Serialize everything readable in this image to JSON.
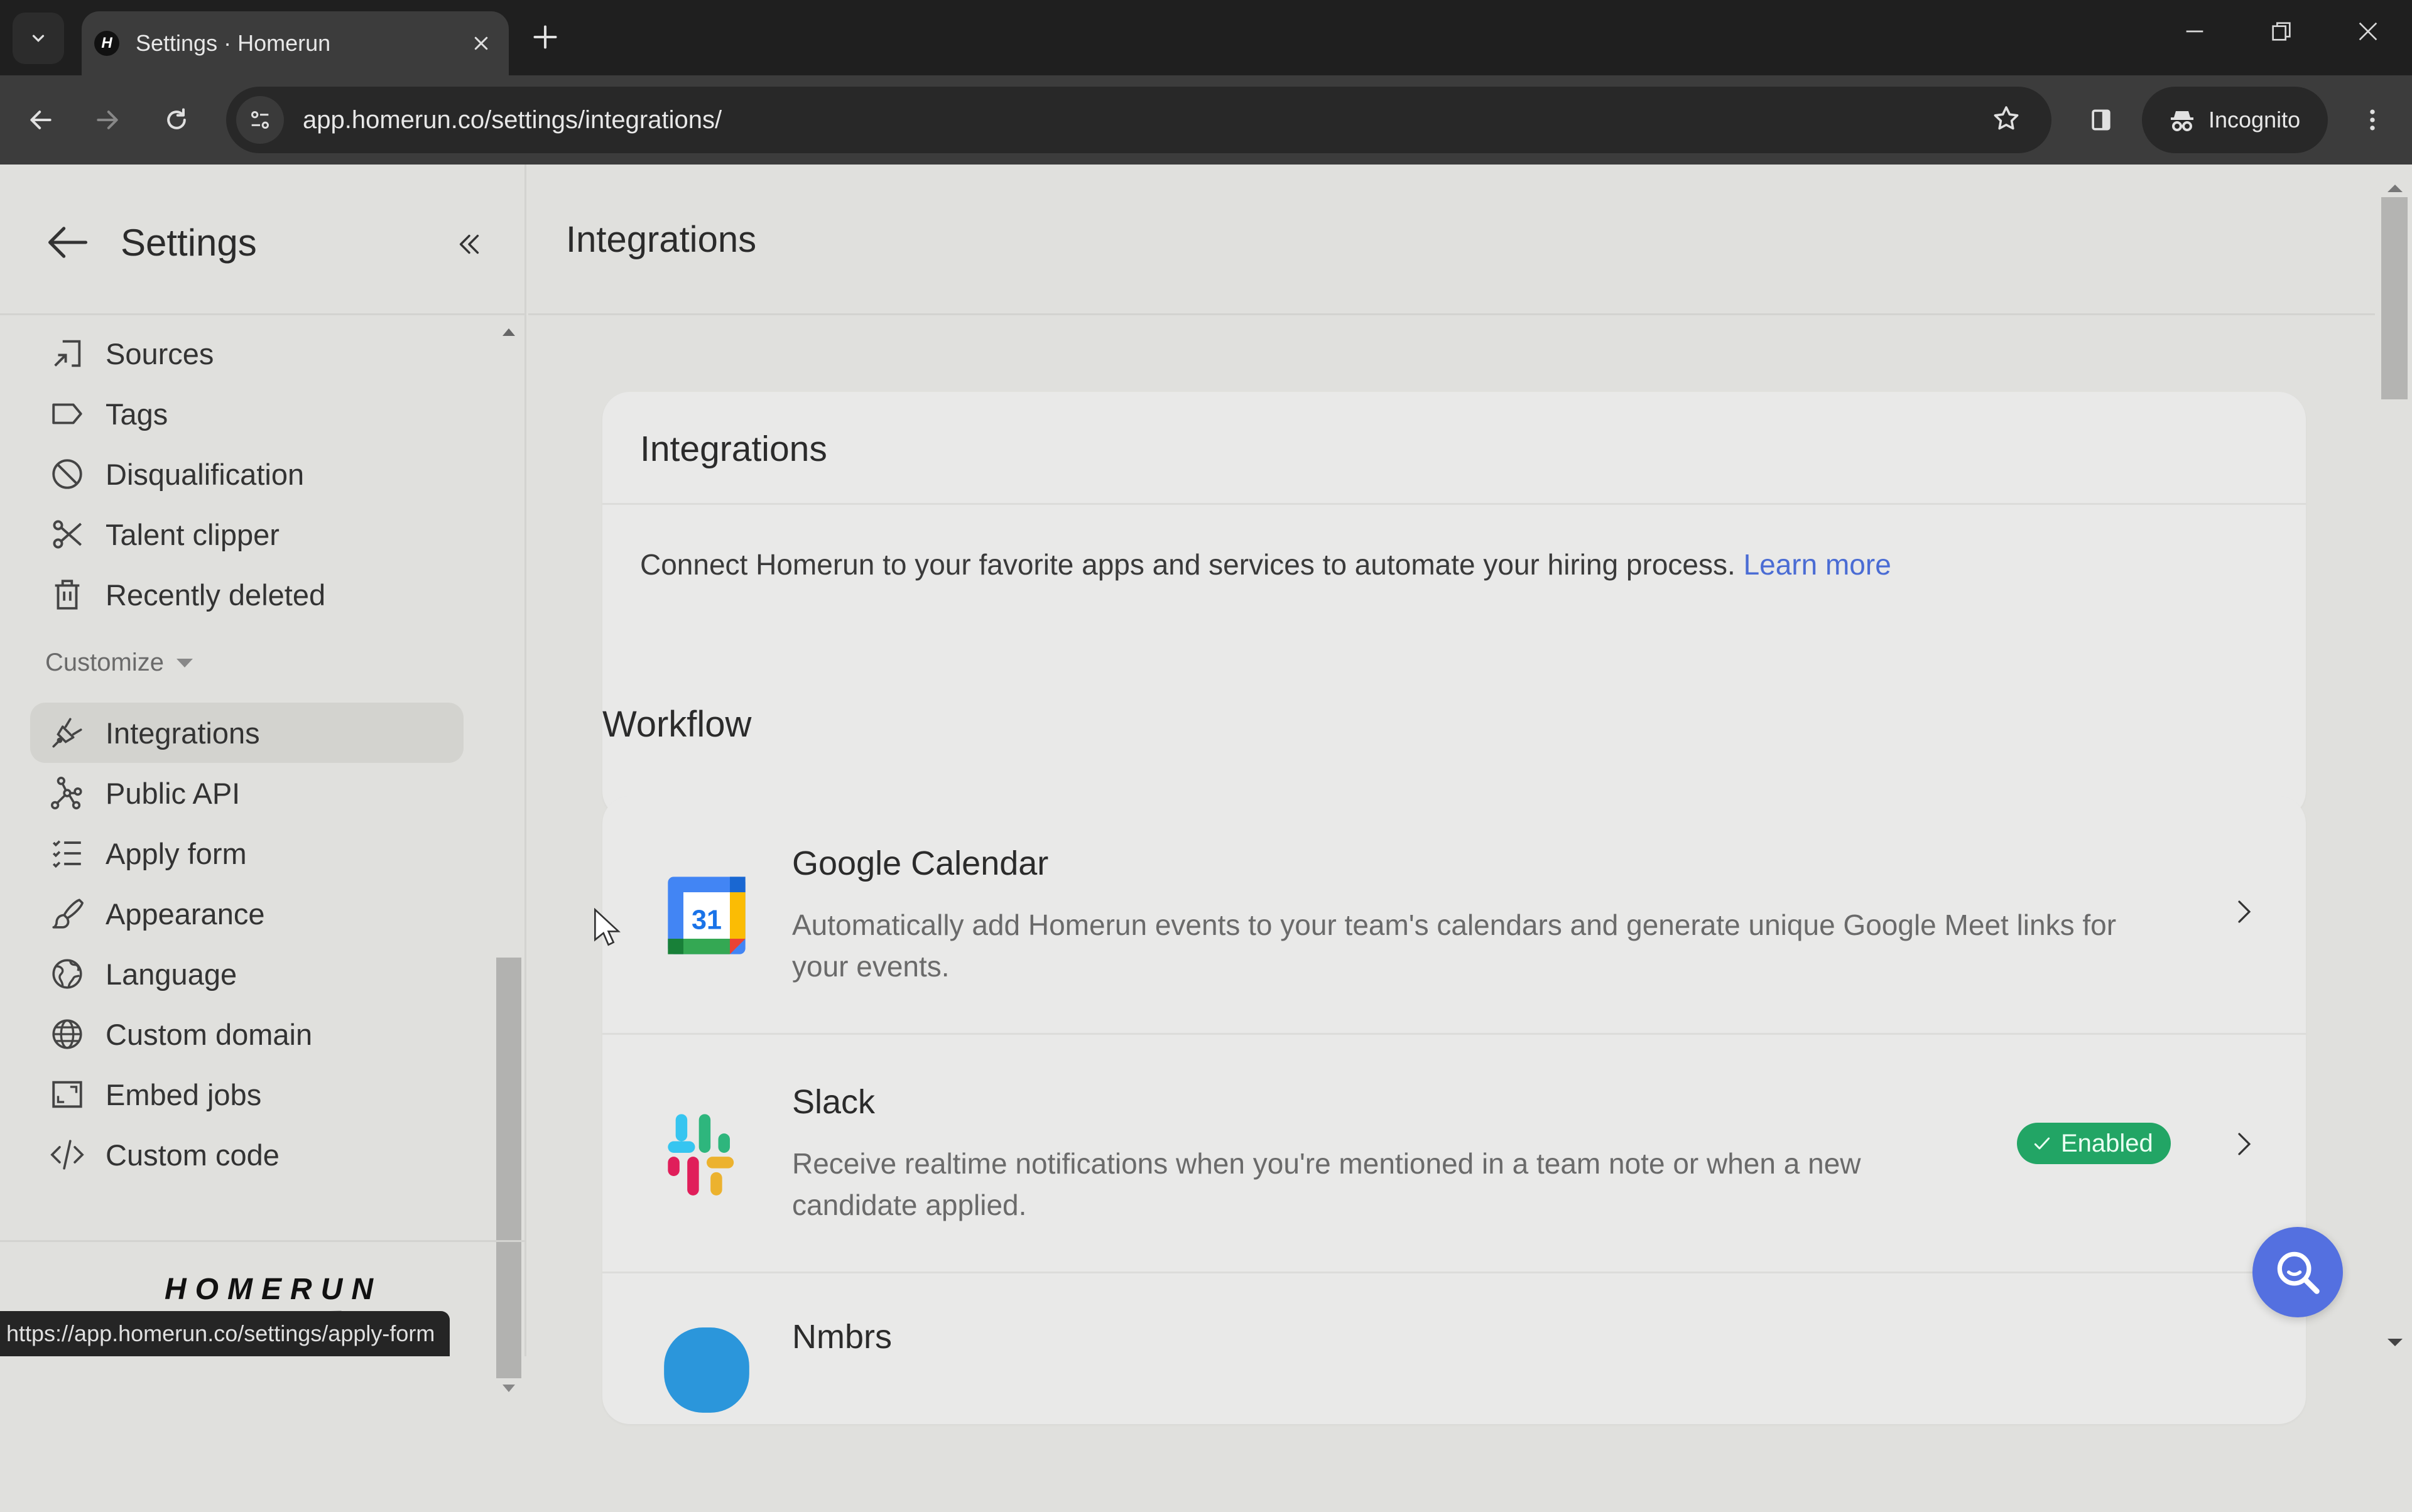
{
  "browser": {
    "tab_title": "Settings · Homerun",
    "favicon_letter": "H",
    "url": "app.homerun.co/settings/integrations/",
    "incognito_label": "Incognito",
    "status_url": "https://app.homerun.co/settings/apply-form"
  },
  "sidebar": {
    "title": "Settings",
    "items_top": [
      {
        "label": "Sources",
        "icon": "sources-icon"
      },
      {
        "label": "Tags",
        "icon": "tag-icon"
      },
      {
        "label": "Disqualification",
        "icon": "block-icon"
      },
      {
        "label": "Talent clipper",
        "icon": "scissors-icon"
      },
      {
        "label": "Recently deleted",
        "icon": "trash-icon"
      }
    ],
    "section_label": "Customize",
    "items_customize": [
      {
        "label": "Integrations",
        "icon": "plug-icon",
        "active": true
      },
      {
        "label": "Public API",
        "icon": "api-nodes-icon"
      },
      {
        "label": "Apply form",
        "icon": "checklist-icon"
      },
      {
        "label": "Appearance",
        "icon": "brush-icon"
      },
      {
        "label": "Language",
        "icon": "language-globe-icon"
      },
      {
        "label": "Custom domain",
        "icon": "globe-icon"
      },
      {
        "label": "Embed jobs",
        "icon": "embed-icon"
      },
      {
        "label": "Custom code",
        "icon": "code-icon"
      }
    ],
    "brand": "HOMERUN"
  },
  "main": {
    "page_title": "Integrations",
    "intro": {
      "title": "Integrations",
      "text": "Connect Homerun to your favorite apps and services to automate your hiring process.",
      "link": "Learn more"
    },
    "section_title": "Workflow",
    "integrations": [
      {
        "name": "Google Calendar",
        "description": "Automatically add Homerun events to your team's calendars and generate unique Google Meet links for your events.",
        "logo_text": "31",
        "status": ""
      },
      {
        "name": "Slack",
        "description": "Receive realtime notifications when you're mentioned in a team note or when a new candidate applied.",
        "status": "Enabled"
      },
      {
        "name": "Nmbrs",
        "description": "",
        "status": ""
      }
    ]
  },
  "colors": {
    "accent_link": "#4a6cd4",
    "enabled_badge": "#22a565",
    "help_fab": "#5470e0"
  }
}
